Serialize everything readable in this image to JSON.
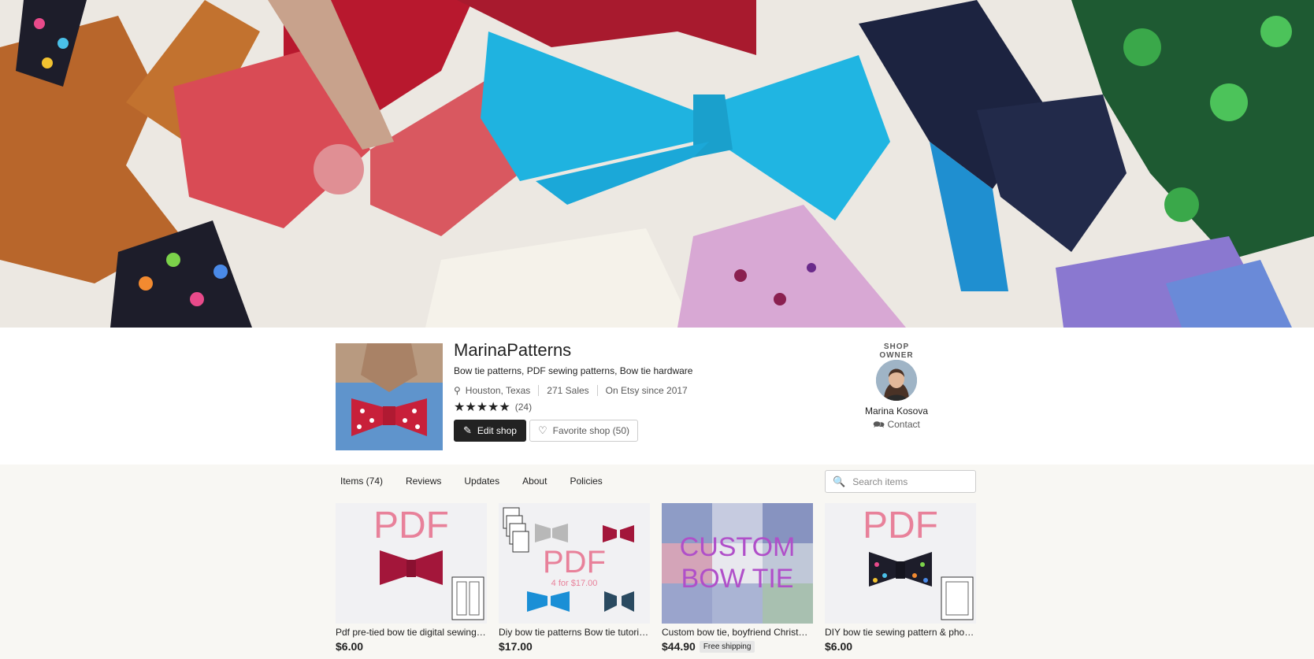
{
  "banner": {
    "alt": "Assorted bow ties banner"
  },
  "shop": {
    "name": "MarinaPatterns",
    "tagline": "Bow tie patterns, PDF sewing patterns, Bow tie hardware",
    "location": "Houston, Texas",
    "sales": "271 Sales",
    "since": "On Etsy since 2017",
    "rating_stars": 5,
    "review_count": "(24)",
    "edit_label": "Edit shop",
    "favorite_label": "Favorite shop (50)"
  },
  "owner": {
    "label": "SHOP OWNER",
    "name": "Marina Kosova",
    "contact": "Contact"
  },
  "tabs": [
    {
      "label": "Items (74)"
    },
    {
      "label": "Reviews"
    },
    {
      "label": "Updates"
    },
    {
      "label": "About"
    },
    {
      "label": "Policies"
    }
  ],
  "search": {
    "placeholder": "Search items"
  },
  "listings": [
    {
      "title": "Pdf pre-tied bow tie digital sewing pattern",
      "price": "$6.00",
      "badge": "",
      "thumb_text": "PDF",
      "thumb_sub": ""
    },
    {
      "title": "Diy bow tie patterns Bow tie tutorial set",
      "price": "$17.00",
      "badge": "",
      "thumb_text": "PDF",
      "thumb_sub": "4 for $17.00"
    },
    {
      "title": "Custom bow tie, boyfriend Christmas gift",
      "price": "$44.90",
      "badge": "Free shipping",
      "thumb_text": "CUSTOM",
      "thumb_sub": "BOW TIE"
    },
    {
      "title": "DIY bow tie sewing pattern & photo tutorial",
      "price": "$6.00",
      "badge": "",
      "thumb_text": "PDF",
      "thumb_sub": ""
    }
  ],
  "colors": {
    "edit_button": "#222222",
    "pdf_pink": "#e8819a",
    "custom_purple": "#b04fc9"
  }
}
